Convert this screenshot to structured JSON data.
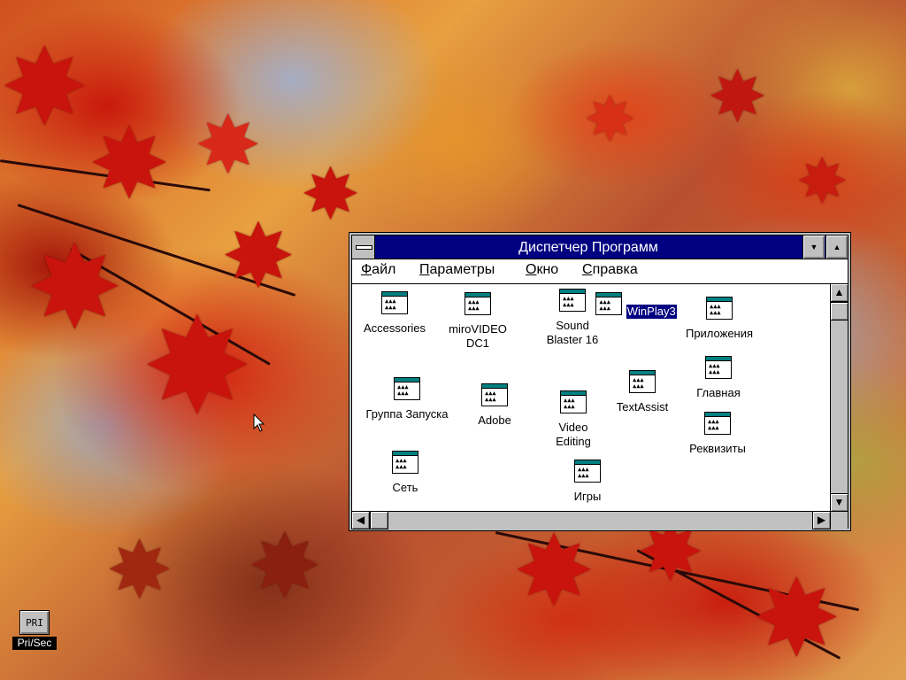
{
  "window": {
    "title": "Диспетчер Программ",
    "menu": [
      {
        "underlined": "Ф",
        "rest": "айл"
      },
      {
        "underlined": "П",
        "rest": "араметры"
      },
      {
        "underlined": "О",
        "rest": "кно"
      },
      {
        "underlined": "С",
        "rest": "правка"
      }
    ],
    "min_glyph": "▼",
    "max_glyph": "▲"
  },
  "groups": [
    {
      "label": "Accessories"
    },
    {
      "label": "miroVIDEO\nDC1"
    },
    {
      "label": "Sound\nBlaster 16"
    },
    {
      "label": "WinPlay3",
      "selected": true
    },
    {
      "label": "Приложения"
    },
    {
      "label": "Группа Запуска"
    },
    {
      "label": "Adobe"
    },
    {
      "label": "Video\nEditing"
    },
    {
      "label": "TextAssist"
    },
    {
      "label": "Главная"
    },
    {
      "label": "Реквизиты"
    },
    {
      "label": "Сеть"
    },
    {
      "label": "Игры"
    }
  ],
  "scrollbars": {
    "up": "▲",
    "down": "▼",
    "left": "◀",
    "right": "▶"
  },
  "desktop_icon": {
    "icon_text": "PRI",
    "label": "Pri/Sec"
  },
  "colors": {
    "titlebar": "#000080",
    "window_face": "#c0c0c0",
    "selection": "#000080",
    "group_icon_title": "#008080"
  }
}
